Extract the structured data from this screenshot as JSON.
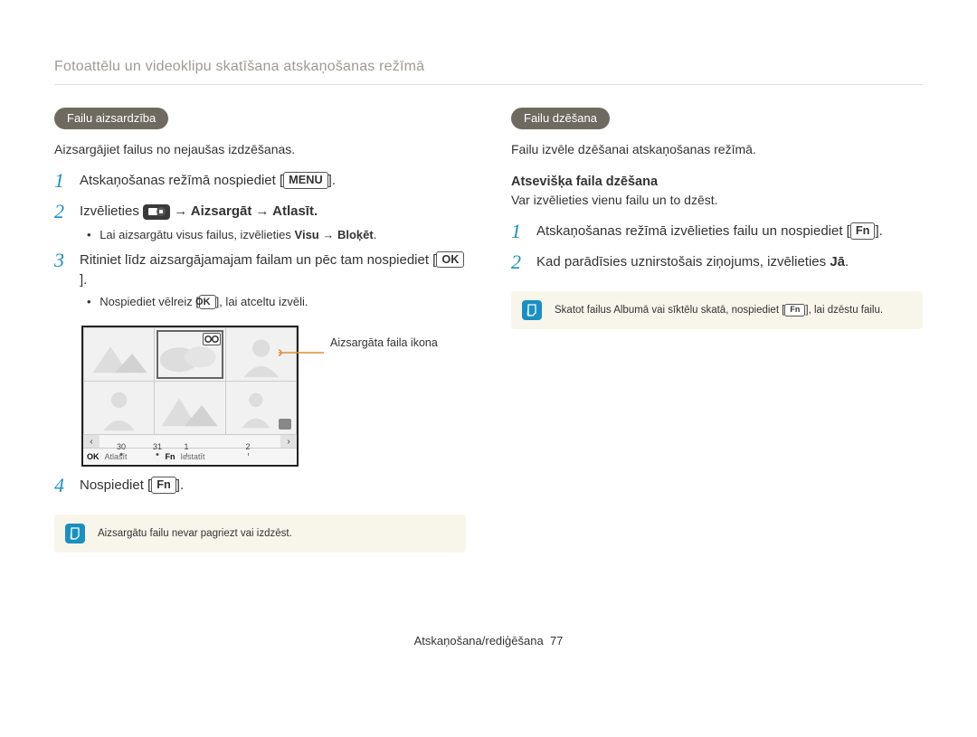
{
  "header": "Fotoattēlu un videoklipu skatīšana atskaņošanas režīmā",
  "left": {
    "pill": "Failu aizsardzība",
    "lead": "Aizsargājiet failus no nejaušas izdzēšanas.",
    "step1_a": "Atskaņošanas režīmā nospiediet [",
    "step1_btn": "MENU",
    "step1_b": "].",
    "step2_a": "Izvēlieties ",
    "step2_b": " → Aizsargāt → Atlasīt.",
    "bullet2_a": "Lai aizsargātu visus failus, izvēlieties ",
    "bullet2_b": "Visu → Bloķēt",
    "bullet2_c": ".",
    "step3_a": "Ritiniet līdz aizsargājamajam failam un pēc tam nospiediet [",
    "step3_btn": "OK",
    "step3_b": "].",
    "bullet3_a": "Nospiediet vēlreiz [",
    "bullet3_btn": "OK",
    "bullet3_b": "], lai atceltu izvēli.",
    "callout": "Aizsargāta faila ikona",
    "scroll_ticks": [
      "30",
      "31",
      "1",
      "2"
    ],
    "status_ok": "OK",
    "status_ok_label": "Atlasīt",
    "status_fn": "Fn",
    "status_fn_label": "Iestatīt",
    "step4_a": "Nospiediet [",
    "step4_btn": "Fn",
    "step4_b": "].",
    "note": "Aizsargātu failu nevar pagriezt vai izdzēst."
  },
  "right": {
    "pill": "Failu dzēšana",
    "lead": "Failu izvēle dzēšanai atskaņošanas režīmā.",
    "subhead": "Atsevišķa faila dzēšana",
    "sublead": "Var izvēlieties vienu failu un to dzēst.",
    "step1_a": "Atskaņošanas režīmā izvēlieties failu un nospiediet [",
    "step1_btn": "Fn",
    "step1_b": "].",
    "step2_a": "Kad parādīsies uznirstošais ziņojums, izvēlieties ",
    "step2_b": "Jā",
    "step2_c": ".",
    "note_a": "Skatot failus Albumā vai sīktēlu skatā, nospiediet [",
    "note_btn": "Fn",
    "note_b": "], lai dzēstu failu."
  },
  "footer_a": "Atskaņošana/rediģēšana",
  "footer_b": "77"
}
